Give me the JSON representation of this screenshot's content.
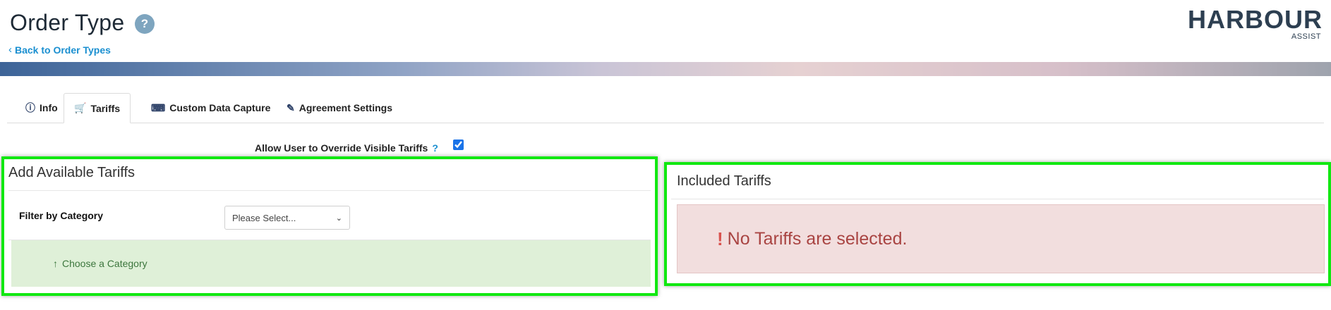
{
  "header": {
    "title": "Order Type",
    "help_icon": "?",
    "back_link": "Back to Order Types"
  },
  "logo": {
    "main": "HARBOUR",
    "sub": "ASSIST"
  },
  "tabs": [
    {
      "label": "Info",
      "icon": "info-icon",
      "active": false
    },
    {
      "label": "Tariffs",
      "icon": "cart-icon",
      "active": true
    },
    {
      "label": "Custom Data Capture",
      "icon": "keyboard-icon",
      "active": false
    },
    {
      "label": "Agreement Settings",
      "icon": "pen-icon",
      "active": false
    }
  ],
  "override": {
    "label": "Allow User to Override Visible Tariffs",
    "help": "?",
    "checked": true
  },
  "available": {
    "title": "Add Available Tariffs",
    "filter_label": "Filter by Category",
    "select_value": "Please Select...",
    "hint": "Choose a Category"
  },
  "included": {
    "title": "Included Tariffs",
    "empty_message": "No Tariffs are selected."
  },
  "colors": {
    "highlight": "#11e811",
    "link": "#1a8fd0",
    "success_bg": "#dff0d8",
    "danger_bg": "#f2dede",
    "danger_text": "#a94442"
  }
}
